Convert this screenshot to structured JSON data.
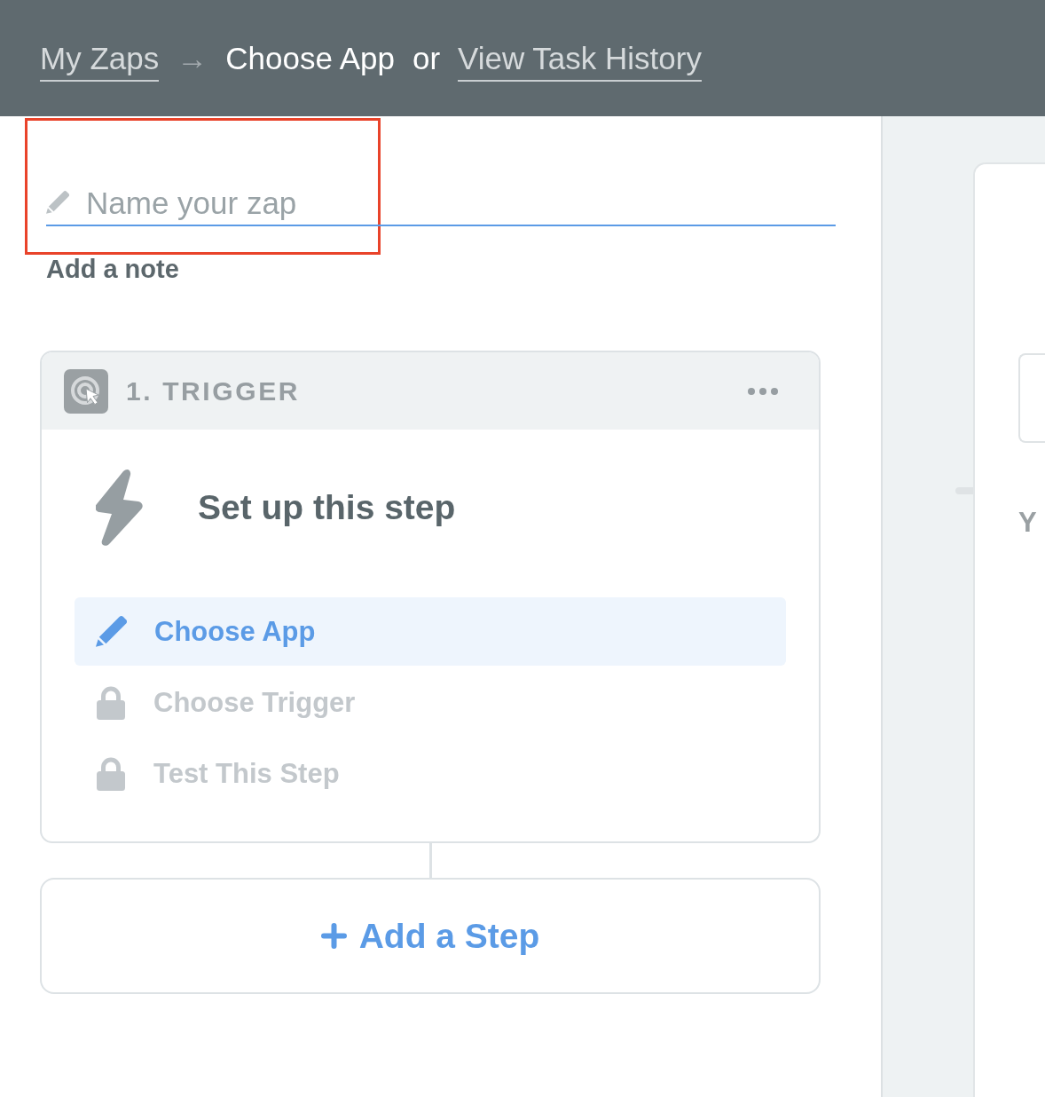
{
  "breadcrumb": [
    {
      "kind": "link",
      "label": "My Zaps"
    },
    {
      "kind": "separator",
      "label": "→"
    },
    {
      "kind": "current",
      "label": "Choose App"
    },
    {
      "kind": "text",
      "label": "or"
    },
    {
      "kind": "link",
      "label": "View Task History"
    }
  ],
  "zap_name": {
    "placeholder": "Name your zap",
    "highlighted": true
  },
  "note_link": "Add a note",
  "trigger": {
    "number_label": "1. TRIGGER",
    "title": "Set up this step",
    "steps": [
      {
        "label": "Choose App",
        "selected": true,
        "locked": false
      },
      {
        "label": "Choose Trigger",
        "selected": false,
        "locked": true
      },
      {
        "label": "Test This Step",
        "selected": false,
        "locked": true
      }
    ]
  },
  "add_step": "Add a Step",
  "side_panel": {
    "heading": "Y"
  }
}
